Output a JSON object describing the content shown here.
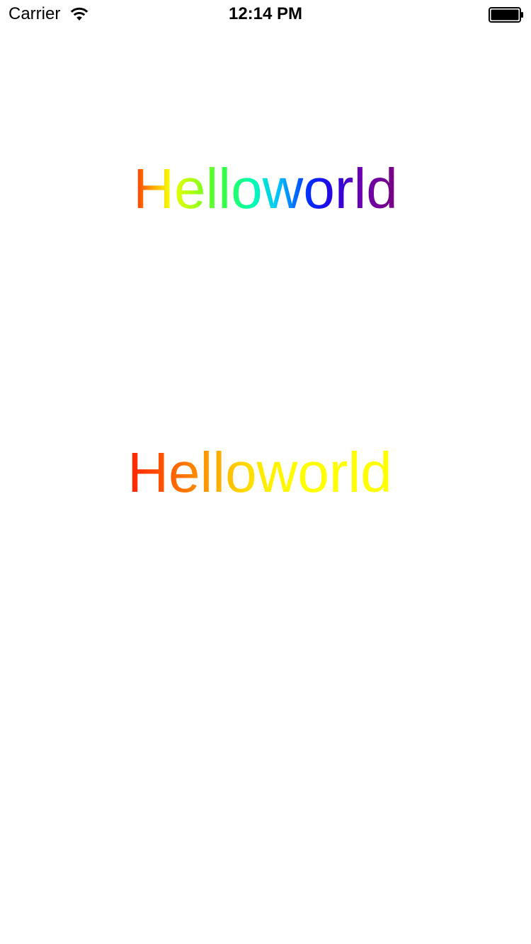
{
  "status_bar": {
    "carrier": "Carrier",
    "time": "12:14 PM",
    "wifi_icon": "wifi-icon",
    "battery_icon": "battery-icon",
    "battery_level": 1.0
  },
  "main": {
    "label_1": {
      "text": "Helloworld",
      "gradient_colors": [
        "#ff2a00",
        "#ffa000",
        "#f5ff00",
        "#3dff3d",
        "#00ffb0",
        "#00c0ff",
        "#0030ff",
        "#6a00b0",
        "#7a0080"
      ]
    },
    "label_2": {
      "text": "Helloworld",
      "gradient_colors": [
        "#ff2000",
        "#ff9a00",
        "#ffee00",
        "#ffff00"
      ]
    }
  }
}
